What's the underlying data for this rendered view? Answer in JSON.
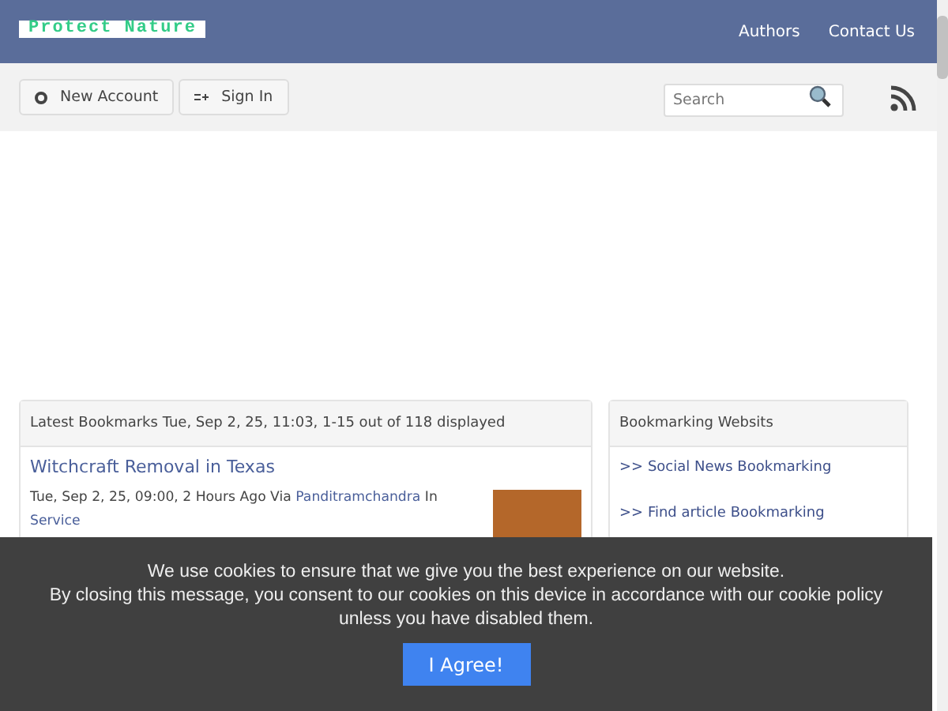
{
  "header": {
    "logo": "Protect Nature",
    "nav": [
      "Authors",
      "Contact Us"
    ]
  },
  "toolbar": {
    "buttons": [
      {
        "label": "New Account",
        "kind": "gear"
      },
      {
        "label": "Sign In",
        "kind": "signin"
      }
    ],
    "search": {
      "placeholder": "Search"
    }
  },
  "bookmarks": {
    "heading": "Latest Bookmarks Tue, Sep 2, 25, 11:03, 1-15 out of 118 displayed",
    "items": [
      {
        "title": "Witchcraft Removal in Texas",
        "meta": "Tue, Sep 2, 25, 09:00, 2 Hours Ago Via",
        "author": "Panditramchandra",
        "in": "In",
        "category": "Service"
      }
    ]
  },
  "sidebar": {
    "heading": "Bookmarking Websits",
    "links": [
      ">> Social News Bookmarking",
      ">> Find article Bookmarking"
    ]
  },
  "cookie_banner": {
    "lines": [
      "We use cookies to ensure that we give you the best experience on our website.",
      "By closing this message, you consent to our cookies on this device in accordance with our cookie policy unless you have disabled them."
    ],
    "button": "I Agree!"
  }
}
